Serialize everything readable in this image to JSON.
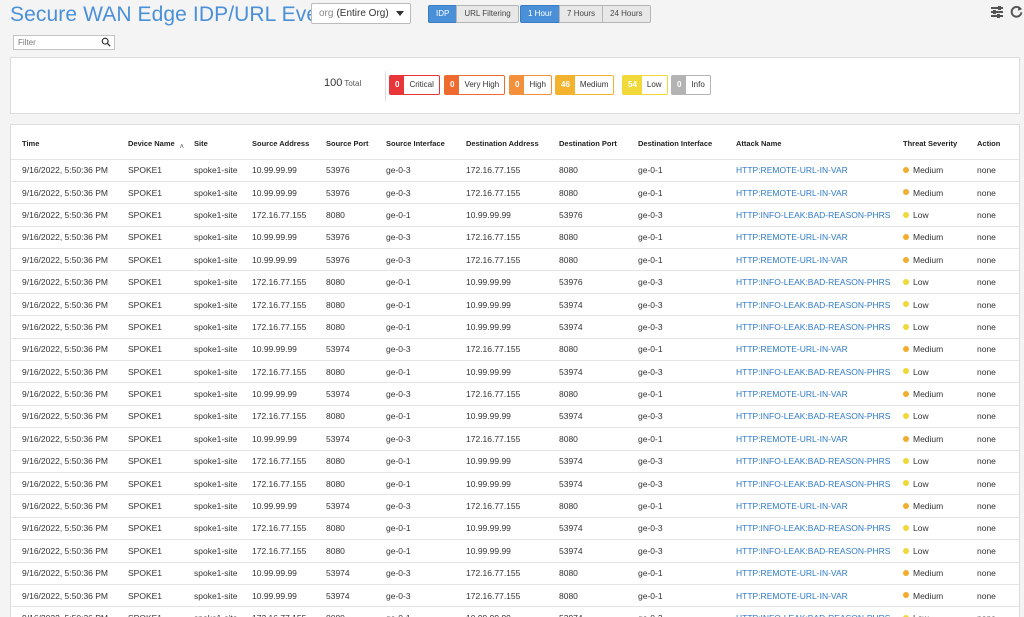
{
  "header": {
    "title": "Secure WAN Edge IDP/URL Events",
    "org_select": {
      "prefix": "org",
      "value": "(Entire Org)"
    },
    "type_buttons": [
      {
        "label": "IDP",
        "active": true
      },
      {
        "label": "URL Filtering",
        "active": false
      }
    ],
    "time_buttons": [
      {
        "label": "1 Hour",
        "active": true
      },
      {
        "label": "7 Hours",
        "active": false
      },
      {
        "label": "24 Hours",
        "active": false
      }
    ],
    "icons": [
      "filter-lines-icon",
      "refresh-icon"
    ]
  },
  "filter": {
    "placeholder": "Filter",
    "icon": "search-icon"
  },
  "summary": {
    "total_value": "100",
    "total_label": "Total",
    "badges": [
      {
        "count": "0",
        "label": "Critical",
        "color": "#e8353a"
      },
      {
        "count": "0",
        "label": "Very High",
        "color": "#ef6a2e"
      },
      {
        "count": "0",
        "label": "High",
        "color": "#f2903c"
      },
      {
        "count": "46",
        "label": "Medium",
        "color": "#f3b32e"
      },
      {
        "count": "54",
        "label": "Low",
        "color": "#f1d93b"
      },
      {
        "count": "0",
        "label": "Info",
        "color": "#b3b3b3"
      }
    ]
  },
  "severity_colors": {
    "Medium": "#f0ad30",
    "Low": "#eed83a"
  },
  "table": {
    "columns": [
      "Time",
      "Device Name",
      "Site",
      "Source Address",
      "Source Port",
      "Source Interface",
      "Destination Address",
      "Destination Port",
      "Destination Interface",
      "Attack Name",
      "Threat Severity",
      "Action"
    ],
    "rows": [
      [
        "9/16/2022, 5:50:36 PM",
        "SPOKE1",
        "spoke1-site",
        "10.99.99.99",
        "53976",
        "ge-0-3",
        "172.16.77.155",
        "8080",
        "ge-0-1",
        "HTTP:REMOTE-URL-IN-VAR",
        "Medium",
        "none"
      ],
      [
        "9/16/2022, 5:50:36 PM",
        "SPOKE1",
        "spoke1-site",
        "10.99.99.99",
        "53976",
        "ge-0-3",
        "172.16.77.155",
        "8080",
        "ge-0-1",
        "HTTP:REMOTE-URL-IN-VAR",
        "Medium",
        "none"
      ],
      [
        "9/16/2022, 5:50:36 PM",
        "SPOKE1",
        "spoke1-site",
        "172.16.77.155",
        "8080",
        "ge-0-1",
        "10.99.99.99",
        "53976",
        "ge-0-3",
        "HTTP:INFO-LEAK:BAD-REASON-PHRS",
        "Low",
        "none"
      ],
      [
        "9/16/2022, 5:50:36 PM",
        "SPOKE1",
        "spoke1-site",
        "10.99.99.99",
        "53976",
        "ge-0-3",
        "172.16.77.155",
        "8080",
        "ge-0-1",
        "HTTP:REMOTE-URL-IN-VAR",
        "Medium",
        "none"
      ],
      [
        "9/16/2022, 5:50:36 PM",
        "SPOKE1",
        "spoke1-site",
        "10.99.99.99",
        "53976",
        "ge-0-3",
        "172.16.77.155",
        "8080",
        "ge-0-1",
        "HTTP:REMOTE-URL-IN-VAR",
        "Medium",
        "none"
      ],
      [
        "9/16/2022, 5:50:36 PM",
        "SPOKE1",
        "spoke1-site",
        "172.16.77.155",
        "8080",
        "ge-0-1",
        "10.99.99.99",
        "53976",
        "ge-0-3",
        "HTTP:INFO-LEAK:BAD-REASON-PHRS",
        "Low",
        "none"
      ],
      [
        "9/16/2022, 5:50:36 PM",
        "SPOKE1",
        "spoke1-site",
        "172.16.77.155",
        "8080",
        "ge-0-1",
        "10.99.99.99",
        "53974",
        "ge-0-3",
        "HTTP:INFO-LEAK:BAD-REASON-PHRS",
        "Low",
        "none"
      ],
      [
        "9/16/2022, 5:50:36 PM",
        "SPOKE1",
        "spoke1-site",
        "172.16.77.155",
        "8080",
        "ge-0-1",
        "10.99.99.99",
        "53974",
        "ge-0-3",
        "HTTP:INFO-LEAK:BAD-REASON-PHRS",
        "Low",
        "none"
      ],
      [
        "9/16/2022, 5:50:36 PM",
        "SPOKE1",
        "spoke1-site",
        "10.99.99.99",
        "53974",
        "ge-0-3",
        "172.16.77.155",
        "8080",
        "ge-0-1",
        "HTTP:REMOTE-URL-IN-VAR",
        "Medium",
        "none"
      ],
      [
        "9/16/2022, 5:50:36 PM",
        "SPOKE1",
        "spoke1-site",
        "172.16.77.155",
        "8080",
        "ge-0-1",
        "10.99.99.99",
        "53974",
        "ge-0-3",
        "HTTP:INFO-LEAK:BAD-REASON-PHRS",
        "Low",
        "none"
      ],
      [
        "9/16/2022, 5:50:36 PM",
        "SPOKE1",
        "spoke1-site",
        "10.99.99.99",
        "53974",
        "ge-0-3",
        "172.16.77.155",
        "8080",
        "ge-0-1",
        "HTTP:REMOTE-URL-IN-VAR",
        "Medium",
        "none"
      ],
      [
        "9/16/2022, 5:50:36 PM",
        "SPOKE1",
        "spoke1-site",
        "172.16.77.155",
        "8080",
        "ge-0-1",
        "10.99.99.99",
        "53974",
        "ge-0-3",
        "HTTP:INFO-LEAK:BAD-REASON-PHRS",
        "Low",
        "none"
      ],
      [
        "9/16/2022, 5:50:36 PM",
        "SPOKE1",
        "spoke1-site",
        "10.99.99.99",
        "53974",
        "ge-0-3",
        "172.16.77.155",
        "8080",
        "ge-0-1",
        "HTTP:REMOTE-URL-IN-VAR",
        "Medium",
        "none"
      ],
      [
        "9/16/2022, 5:50:36 PM",
        "SPOKE1",
        "spoke1-site",
        "172.16.77.155",
        "8080",
        "ge-0-1",
        "10.99.99.99",
        "53974",
        "ge-0-3",
        "HTTP:INFO-LEAK:BAD-REASON-PHRS",
        "Low",
        "none"
      ],
      [
        "9/16/2022, 5:50:36 PM",
        "SPOKE1",
        "spoke1-site",
        "172.16.77.155",
        "8080",
        "ge-0-1",
        "10.99.99.99",
        "53974",
        "ge-0-3",
        "HTTP:INFO-LEAK:BAD-REASON-PHRS",
        "Low",
        "none"
      ],
      [
        "9/16/2022, 5:50:36 PM",
        "SPOKE1",
        "spoke1-site",
        "10.99.99.99",
        "53974",
        "ge-0-3",
        "172.16.77.155",
        "8080",
        "ge-0-1",
        "HTTP:REMOTE-URL-IN-VAR",
        "Medium",
        "none"
      ],
      [
        "9/16/2022, 5:50:36 PM",
        "SPOKE1",
        "spoke1-site",
        "172.16.77.155",
        "8080",
        "ge-0-1",
        "10.99.99.99",
        "53974",
        "ge-0-3",
        "HTTP:INFO-LEAK:BAD-REASON-PHRS",
        "Low",
        "none"
      ],
      [
        "9/16/2022, 5:50:36 PM",
        "SPOKE1",
        "spoke1-site",
        "172.16.77.155",
        "8080",
        "ge-0-1",
        "10.99.99.99",
        "53974",
        "ge-0-3",
        "HTTP:INFO-LEAK:BAD-REASON-PHRS",
        "Low",
        "none"
      ],
      [
        "9/16/2022, 5:50:36 PM",
        "SPOKE1",
        "spoke1-site",
        "10.99.99.99",
        "53974",
        "ge-0-3",
        "172.16.77.155",
        "8080",
        "ge-0-1",
        "HTTP:REMOTE-URL-IN-VAR",
        "Medium",
        "none"
      ],
      [
        "9/16/2022, 5:50:36 PM",
        "SPOKE1",
        "spoke1-site",
        "10.99.99.99",
        "53974",
        "ge-0-3",
        "172.16.77.155",
        "8080",
        "ge-0-1",
        "HTTP:REMOTE-URL-IN-VAR",
        "Medium",
        "none"
      ],
      [
        "9/16/2022, 5:50:36 PM",
        "SPOKE1",
        "spoke1-site",
        "172.16.77.155",
        "8080",
        "ge-0-1",
        "10.99.99.99",
        "53974",
        "ge-0-3",
        "HTTP:INFO-LEAK:BAD-REASON-PHRS",
        "Low",
        "none"
      ]
    ]
  }
}
